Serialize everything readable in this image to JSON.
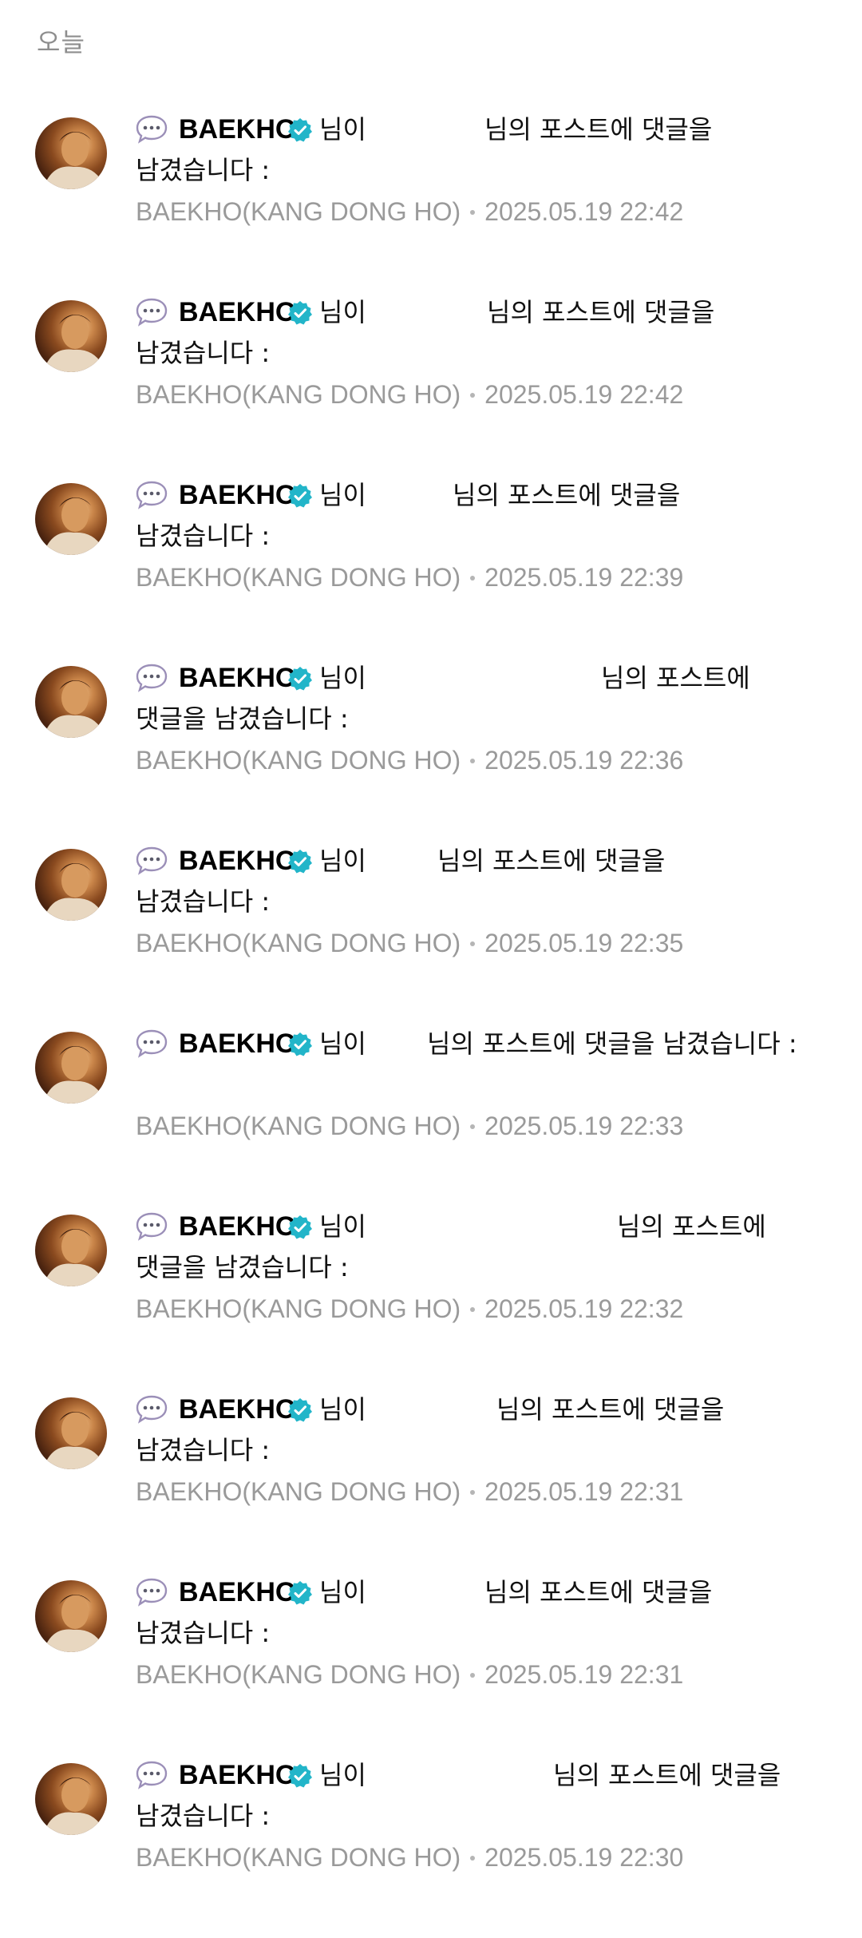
{
  "section": {
    "title": "오늘"
  },
  "colors": {
    "verified": "#22b5c9",
    "meta_text": "#9a9a9a",
    "header_text": "#8e8e8e"
  },
  "icons": {
    "bubble": "speech-bubble-icon",
    "verified": "verified-badge-icon"
  },
  "notifications": [
    {
      "author": "BAEKHO",
      "suffix": "님이",
      "line1_msg": "님의 포스트에 댓글을",
      "line2": "남겼습니다 :",
      "channel": "BAEKHO(KANG DONG HO)",
      "time": "2025.05.19 22:42"
    },
    {
      "author": "BAEKHO",
      "suffix": "님이",
      "line1_msg": "님의 포스트에 댓글을",
      "line2": "남겼습니다 :",
      "channel": "BAEKHO(KANG DONG HO)",
      "time": "2025.05.19 22:42"
    },
    {
      "author": "BAEKHO",
      "suffix": "님이",
      "line1_msg": "님의 포스트에 댓글을",
      "line2": "남겼습니다 :",
      "channel": "BAEKHO(KANG DONG HO)",
      "time": "2025.05.19 22:39"
    },
    {
      "author": "BAEKHO",
      "suffix": "님이",
      "line1_msg": "님의 포스트에",
      "line2": "댓글을 남겼습니다 :",
      "channel": "BAEKHO(KANG DONG HO)",
      "time": "2025.05.19 22:36"
    },
    {
      "author": "BAEKHO",
      "suffix": "님이",
      "line1_msg": "님의 포스트에 댓글을",
      "line2": "남겼습니다 :",
      "channel": "BAEKHO(KANG DONG HO)",
      "time": "2025.05.19 22:35"
    },
    {
      "author": "BAEKHO",
      "suffix": "님이",
      "line1_msg": "님의 포스트에 댓글을 남겼습니다 :",
      "line2": "",
      "channel": "BAEKHO(KANG DONG HO)",
      "time": "2025.05.19 22:33"
    },
    {
      "author": "BAEKHO",
      "suffix": "님이",
      "line1_msg": "님의 포스트에",
      "line2": "댓글을 남겼습니다 :",
      "channel": "BAEKHO(KANG DONG HO)",
      "time": "2025.05.19 22:32"
    },
    {
      "author": "BAEKHO",
      "suffix": "님이",
      "line1_msg": "님의 포스트에 댓글을",
      "line2": "남겼습니다 :",
      "channel": "BAEKHO(KANG DONG HO)",
      "time": "2025.05.19 22:31"
    },
    {
      "author": "BAEKHO",
      "suffix": "님이",
      "line1_msg": "님의 포스트에 댓글을",
      "line2": "남겼습니다 :",
      "channel": "BAEKHO(KANG DONG HO)",
      "time": "2025.05.19 22:31"
    },
    {
      "author": "BAEKHO",
      "suffix": "님이",
      "line1_msg": "님의 포스트에 댓글을",
      "line2": "남겼습니다 :",
      "channel": "BAEKHO(KANG DONG HO)",
      "time": "2025.05.19 22:30"
    }
  ]
}
